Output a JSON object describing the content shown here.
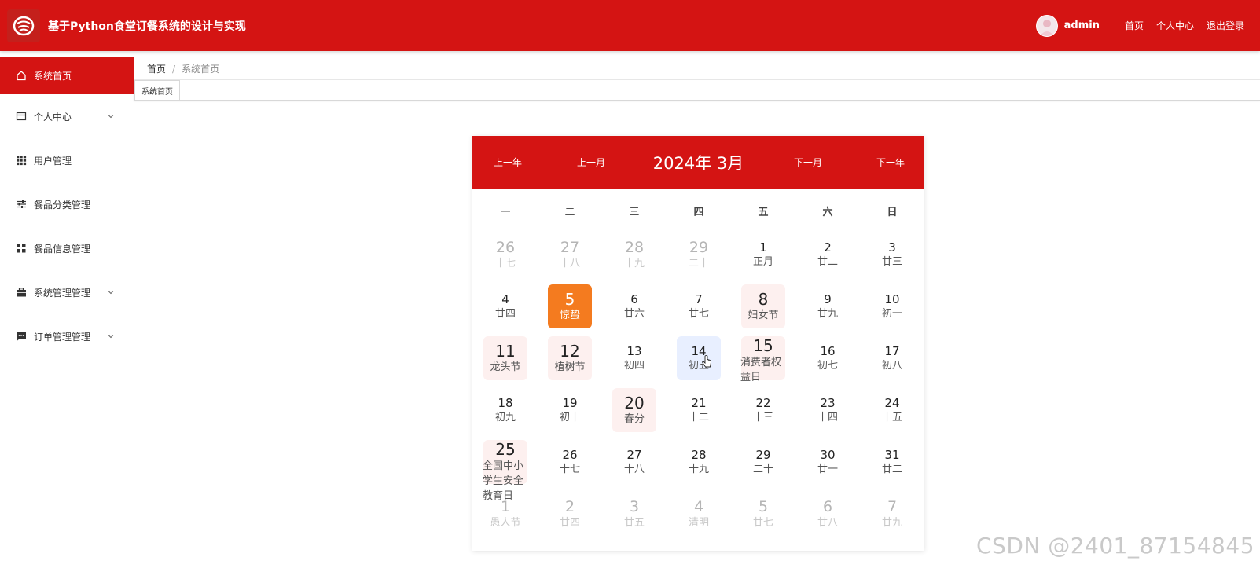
{
  "header": {
    "title": "基于Python食堂订餐系统的设计与实现",
    "username": "admin",
    "links": [
      "首页",
      "个人中心",
      "退出登录"
    ]
  },
  "sidebar": {
    "items": [
      {
        "label": "系统首页",
        "icon": "home-icon",
        "active": true,
        "expandable": false
      },
      {
        "label": "个人中心",
        "icon": "card-icon",
        "active": false,
        "expandable": true
      },
      {
        "label": "用户管理",
        "icon": "grid-icon",
        "active": false,
        "expandable": false
      },
      {
        "label": "餐品分类管理",
        "icon": "sliders-icon",
        "active": false,
        "expandable": false
      },
      {
        "label": "餐品信息管理",
        "icon": "apps-icon",
        "active": false,
        "expandable": false
      },
      {
        "label": "系统管理管理",
        "icon": "briefcase-icon",
        "active": false,
        "expandable": true
      },
      {
        "label": "订单管理管理",
        "icon": "message-icon",
        "active": false,
        "expandable": true
      }
    ]
  },
  "breadcrumb": {
    "home": "首页",
    "separator": "/",
    "current": "系统首页"
  },
  "tabs": [
    {
      "label": "系统首页"
    }
  ],
  "calendar": {
    "prev_year": "上一年",
    "prev_month": "上一月",
    "title": "2024年 3月",
    "next_month": "下一月",
    "next_year": "下一年",
    "weekdays": [
      "一",
      "二",
      "三",
      "四",
      "五",
      "六",
      "日"
    ],
    "weeks": [
      [
        {
          "d": "26",
          "l": "十七",
          "type": "other"
        },
        {
          "d": "27",
          "l": "十八",
          "type": "other"
        },
        {
          "d": "28",
          "l": "十九",
          "type": "other"
        },
        {
          "d": "29",
          "l": "二十",
          "type": "other"
        },
        {
          "d": "1",
          "l": "正月",
          "type": "normal"
        },
        {
          "d": "2",
          "l": "廿二",
          "type": "normal"
        },
        {
          "d": "3",
          "l": "廿三",
          "type": "normal"
        }
      ],
      [
        {
          "d": "4",
          "l": "廿四",
          "type": "normal"
        },
        {
          "d": "5",
          "l": "惊蛰",
          "type": "term"
        },
        {
          "d": "6",
          "l": "廿六",
          "type": "normal"
        },
        {
          "d": "7",
          "l": "廿七",
          "type": "normal"
        },
        {
          "d": "8",
          "l": "妇女节",
          "type": "festival"
        },
        {
          "d": "9",
          "l": "廿九",
          "type": "normal"
        },
        {
          "d": "10",
          "l": "初一",
          "type": "normal"
        }
      ],
      [
        {
          "d": "11",
          "l": "龙头节",
          "type": "festival"
        },
        {
          "d": "12",
          "l": "植树节",
          "type": "festival"
        },
        {
          "d": "13",
          "l": "初四",
          "type": "normal"
        },
        {
          "d": "14",
          "l": "初五",
          "type": "today"
        },
        {
          "d": "15",
          "l": "消费者权益日",
          "type": "festival-wrap"
        },
        {
          "d": "16",
          "l": "初七",
          "type": "normal"
        },
        {
          "d": "17",
          "l": "初八",
          "type": "normal"
        }
      ],
      [
        {
          "d": "18",
          "l": "初九",
          "type": "normal"
        },
        {
          "d": "19",
          "l": "初十",
          "type": "normal"
        },
        {
          "d": "20",
          "l": "春分",
          "type": "festival"
        },
        {
          "d": "21",
          "l": "十二",
          "type": "normal"
        },
        {
          "d": "22",
          "l": "十三",
          "type": "normal"
        },
        {
          "d": "23",
          "l": "十四",
          "type": "normal"
        },
        {
          "d": "24",
          "l": "十五",
          "type": "normal"
        }
      ],
      [
        {
          "d": "25",
          "l": "全国中小学生安全教育日",
          "type": "festival-wrap"
        },
        {
          "d": "26",
          "l": "十七",
          "type": "normal"
        },
        {
          "d": "27",
          "l": "十八",
          "type": "normal"
        },
        {
          "d": "28",
          "l": "十九",
          "type": "normal"
        },
        {
          "d": "29",
          "l": "二十",
          "type": "normal"
        },
        {
          "d": "30",
          "l": "廿一",
          "type": "normal"
        },
        {
          "d": "31",
          "l": "廿二",
          "type": "normal"
        }
      ],
      [
        {
          "d": "1",
          "l": "愚人节",
          "type": "other"
        },
        {
          "d": "2",
          "l": "廿四",
          "type": "other"
        },
        {
          "d": "3",
          "l": "廿五",
          "type": "other"
        },
        {
          "d": "4",
          "l": "清明",
          "type": "other"
        },
        {
          "d": "5",
          "l": "廿七",
          "type": "other"
        },
        {
          "d": "6",
          "l": "廿八",
          "type": "other"
        },
        {
          "d": "7",
          "l": "廿九",
          "type": "other"
        }
      ]
    ]
  },
  "watermark": "CSDN @2401_87154845",
  "colors": {
    "primary": "#d41413",
    "term": "#f47b1f",
    "festival_bg": "#fdf0ef",
    "today_bg": "#e8efff"
  }
}
